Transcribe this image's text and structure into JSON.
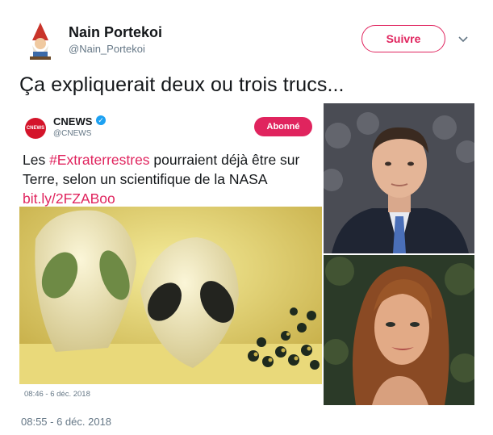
{
  "tweet": {
    "author_name": "Nain Portekoi",
    "author_handle": "@Nain_Portekoi",
    "follow_label": "Suivre",
    "text": "Ça expliquerait deux ou trois trucs...",
    "timestamp": "08:55 - 6 déc. 2018"
  },
  "embedded_tweet": {
    "logo_text": "CNEWS",
    "author_name": "CNEWS",
    "author_handle": "@CNEWS",
    "follow_label": "Abonné",
    "text_before": "Les ",
    "hashtag": "#Extraterrestres",
    "text_after": " pourraient déjà être sur Terre, selon un scientifique de la NASA",
    "link": "bit.ly/2FZABoo",
    "timestamp": "08:46 - 6 déc. 2018"
  },
  "colors": {
    "accent": "#e0245e",
    "text": "#14171a",
    "muted": "#657786",
    "verified": "#1da1f2",
    "cnews_red": "#d4142a"
  },
  "icons": [
    "gnome-avatar-icon",
    "chevron-down-icon",
    "verified-icon"
  ]
}
